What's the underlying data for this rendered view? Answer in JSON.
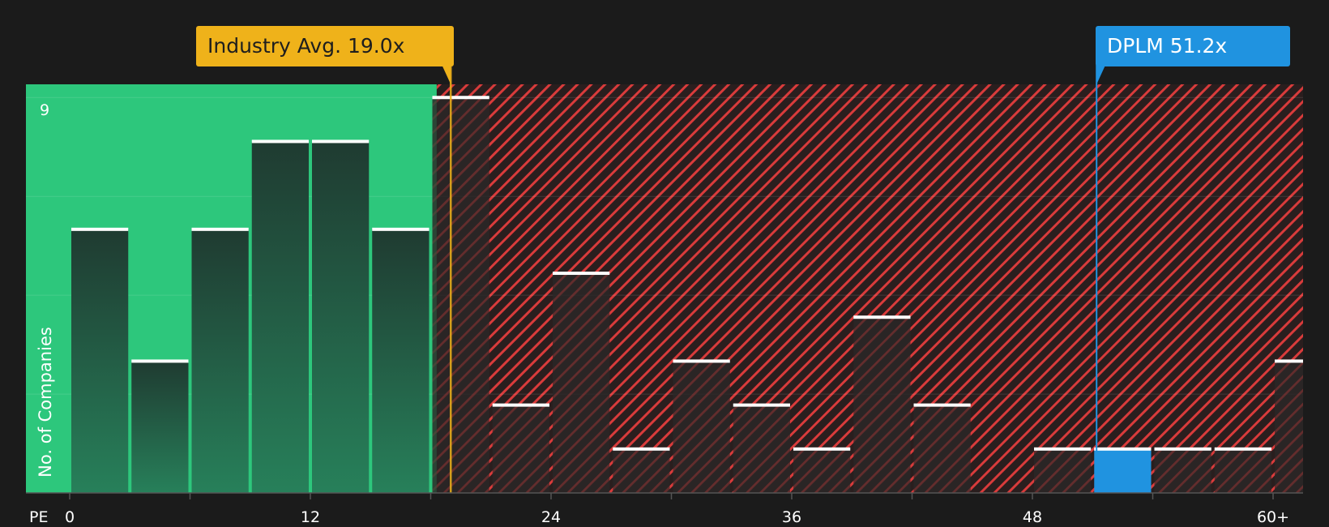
{
  "chart_data": {
    "type": "bar",
    "xlabel": "PE",
    "ylabel": "No. of Companies",
    "x_bin_start": [
      0,
      3,
      6,
      9,
      12,
      15,
      18,
      21,
      24,
      27,
      30,
      33,
      36,
      39,
      42,
      45,
      48,
      51,
      54,
      57,
      60
    ],
    "values": [
      6,
      3,
      6,
      8,
      8,
      6,
      9,
      2,
      5,
      1,
      3,
      2,
      1,
      4,
      2,
      0,
      1,
      1,
      1,
      1,
      3
    ],
    "xlim": [
      0,
      61.5
    ],
    "ylim": [
      0,
      9.3
    ],
    "x_ticks": [
      0,
      12,
      24,
      36,
      48,
      60
    ],
    "x_tick_labels": [
      "0",
      "12",
      "24",
      "36",
      "48",
      "60+"
    ],
    "y_ticks": [
      9
    ],
    "y_tick_labels": [
      "9"
    ],
    "grid": true,
    "fair_zone_end": 18.3,
    "industry_avg": {
      "label": "Industry Avg. 19.0x",
      "value": 19.0,
      "color": "#efb21a"
    },
    "company": {
      "label": "DPLM 51.2x",
      "value": 51.2,
      "highlight_bin_start": 51,
      "color": "#2093e0"
    },
    "colors": {
      "fair_zone": "#2dc77c",
      "over_zone_hatch": "#d93b3b",
      "background": "#1b1b1b"
    }
  }
}
